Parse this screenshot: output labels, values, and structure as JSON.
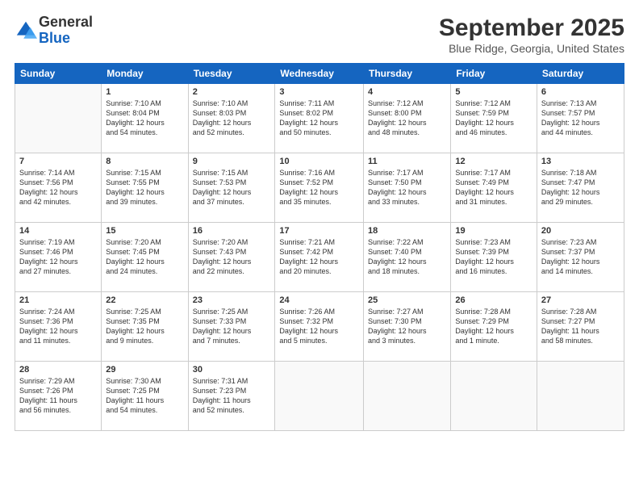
{
  "logo": {
    "line1": "General",
    "line2": "Blue"
  },
  "title": "September 2025",
  "subtitle": "Blue Ridge, Georgia, United States",
  "days_of_week": [
    "Sunday",
    "Monday",
    "Tuesday",
    "Wednesday",
    "Thursday",
    "Friday",
    "Saturday"
  ],
  "weeks": [
    [
      {
        "day": "",
        "info": ""
      },
      {
        "day": "1",
        "info": "Sunrise: 7:10 AM\nSunset: 8:04 PM\nDaylight: 12 hours\nand 54 minutes."
      },
      {
        "day": "2",
        "info": "Sunrise: 7:10 AM\nSunset: 8:03 PM\nDaylight: 12 hours\nand 52 minutes."
      },
      {
        "day": "3",
        "info": "Sunrise: 7:11 AM\nSunset: 8:02 PM\nDaylight: 12 hours\nand 50 minutes."
      },
      {
        "day": "4",
        "info": "Sunrise: 7:12 AM\nSunset: 8:00 PM\nDaylight: 12 hours\nand 48 minutes."
      },
      {
        "day": "5",
        "info": "Sunrise: 7:12 AM\nSunset: 7:59 PM\nDaylight: 12 hours\nand 46 minutes."
      },
      {
        "day": "6",
        "info": "Sunrise: 7:13 AM\nSunset: 7:57 PM\nDaylight: 12 hours\nand 44 minutes."
      }
    ],
    [
      {
        "day": "7",
        "info": "Sunrise: 7:14 AM\nSunset: 7:56 PM\nDaylight: 12 hours\nand 42 minutes."
      },
      {
        "day": "8",
        "info": "Sunrise: 7:15 AM\nSunset: 7:55 PM\nDaylight: 12 hours\nand 39 minutes."
      },
      {
        "day": "9",
        "info": "Sunrise: 7:15 AM\nSunset: 7:53 PM\nDaylight: 12 hours\nand 37 minutes."
      },
      {
        "day": "10",
        "info": "Sunrise: 7:16 AM\nSunset: 7:52 PM\nDaylight: 12 hours\nand 35 minutes."
      },
      {
        "day": "11",
        "info": "Sunrise: 7:17 AM\nSunset: 7:50 PM\nDaylight: 12 hours\nand 33 minutes."
      },
      {
        "day": "12",
        "info": "Sunrise: 7:17 AM\nSunset: 7:49 PM\nDaylight: 12 hours\nand 31 minutes."
      },
      {
        "day": "13",
        "info": "Sunrise: 7:18 AM\nSunset: 7:47 PM\nDaylight: 12 hours\nand 29 minutes."
      }
    ],
    [
      {
        "day": "14",
        "info": "Sunrise: 7:19 AM\nSunset: 7:46 PM\nDaylight: 12 hours\nand 27 minutes."
      },
      {
        "day": "15",
        "info": "Sunrise: 7:20 AM\nSunset: 7:45 PM\nDaylight: 12 hours\nand 24 minutes."
      },
      {
        "day": "16",
        "info": "Sunrise: 7:20 AM\nSunset: 7:43 PM\nDaylight: 12 hours\nand 22 minutes."
      },
      {
        "day": "17",
        "info": "Sunrise: 7:21 AM\nSunset: 7:42 PM\nDaylight: 12 hours\nand 20 minutes."
      },
      {
        "day": "18",
        "info": "Sunrise: 7:22 AM\nSunset: 7:40 PM\nDaylight: 12 hours\nand 18 minutes."
      },
      {
        "day": "19",
        "info": "Sunrise: 7:23 AM\nSunset: 7:39 PM\nDaylight: 12 hours\nand 16 minutes."
      },
      {
        "day": "20",
        "info": "Sunrise: 7:23 AM\nSunset: 7:37 PM\nDaylight: 12 hours\nand 14 minutes."
      }
    ],
    [
      {
        "day": "21",
        "info": "Sunrise: 7:24 AM\nSunset: 7:36 PM\nDaylight: 12 hours\nand 11 minutes."
      },
      {
        "day": "22",
        "info": "Sunrise: 7:25 AM\nSunset: 7:35 PM\nDaylight: 12 hours\nand 9 minutes."
      },
      {
        "day": "23",
        "info": "Sunrise: 7:25 AM\nSunset: 7:33 PM\nDaylight: 12 hours\nand 7 minutes."
      },
      {
        "day": "24",
        "info": "Sunrise: 7:26 AM\nSunset: 7:32 PM\nDaylight: 12 hours\nand 5 minutes."
      },
      {
        "day": "25",
        "info": "Sunrise: 7:27 AM\nSunset: 7:30 PM\nDaylight: 12 hours\nand 3 minutes."
      },
      {
        "day": "26",
        "info": "Sunrise: 7:28 AM\nSunset: 7:29 PM\nDaylight: 12 hours\nand 1 minute."
      },
      {
        "day": "27",
        "info": "Sunrise: 7:28 AM\nSunset: 7:27 PM\nDaylight: 11 hours\nand 58 minutes."
      }
    ],
    [
      {
        "day": "28",
        "info": "Sunrise: 7:29 AM\nSunset: 7:26 PM\nDaylight: 11 hours\nand 56 minutes."
      },
      {
        "day": "29",
        "info": "Sunrise: 7:30 AM\nSunset: 7:25 PM\nDaylight: 11 hours\nand 54 minutes."
      },
      {
        "day": "30",
        "info": "Sunrise: 7:31 AM\nSunset: 7:23 PM\nDaylight: 11 hours\nand 52 minutes."
      },
      {
        "day": "",
        "info": ""
      },
      {
        "day": "",
        "info": ""
      },
      {
        "day": "",
        "info": ""
      },
      {
        "day": "",
        "info": ""
      }
    ]
  ]
}
